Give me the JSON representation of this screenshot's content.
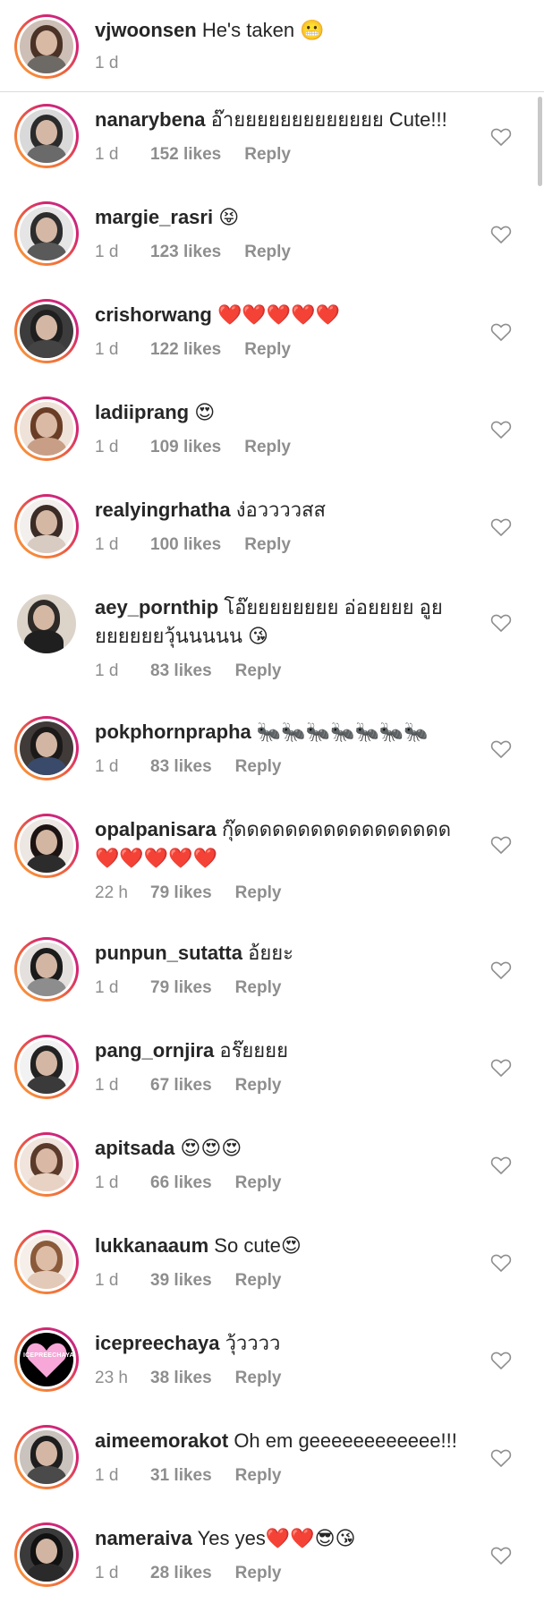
{
  "caption": {
    "username": "vjwoonsen",
    "text": "He's taken 😬",
    "time": "1 d"
  },
  "comments": [
    {
      "username": "nanarybena",
      "text": "อ๊ายยยยยยยยยยยยย Cute!!!",
      "time": "1 d",
      "likes": "152 likes",
      "reply": "Reply"
    },
    {
      "username": "margie_rasri",
      "text": "😝",
      "time": "1 d",
      "likes": "123 likes",
      "reply": "Reply"
    },
    {
      "username": "crishorwang",
      "text": "❤️❤️❤️❤️❤️",
      "time": "1 d",
      "likes": "122 likes",
      "reply": "Reply"
    },
    {
      "username": "ladiiprang",
      "text": "😍",
      "time": "1 d",
      "likes": "109 likes",
      "reply": "Reply"
    },
    {
      "username": "realyingrhatha",
      "text": "ง่อววววสส",
      "time": "1 d",
      "likes": "100 likes",
      "reply": "Reply"
    },
    {
      "username": "aey_pornthip",
      "text": "โอ๊ยยยยยยยย อ่อยยยย อูย ยยยยยยวุ้นนนนน 😘",
      "time": "1 d",
      "likes": "83 likes",
      "reply": "Reply"
    },
    {
      "username": "pokphornprapha",
      "text": "🐜🐜🐜🐜🐜🐜🐜",
      "time": "1 d",
      "likes": "83 likes",
      "reply": "Reply"
    },
    {
      "username": "opalpanisara",
      "text": "กุ๊ดดดดดดดดดดดดดดดดด ❤️❤️❤️❤️❤️",
      "time": "22 h",
      "likes": "79 likes",
      "reply": "Reply"
    },
    {
      "username": "punpun_sutatta",
      "text": "อ้ยยะ",
      "time": "1 d",
      "likes": "79 likes",
      "reply": "Reply"
    },
    {
      "username": "pang_ornjira",
      "text": "อร๊ยยยย",
      "time": "1 d",
      "likes": "67 likes",
      "reply": "Reply"
    },
    {
      "username": "apitsada",
      "text": "😍😍😍",
      "time": "1 d",
      "likes": "66 likes",
      "reply": "Reply"
    },
    {
      "username": "lukkanaaum",
      "text": "So cute😍",
      "time": "1 d",
      "likes": "39 likes",
      "reply": "Reply"
    },
    {
      "username": "icepreechaya",
      "text": "วุ้วววว",
      "time": "23 h",
      "likes": "38 likes",
      "reply": "Reply"
    },
    {
      "username": "aimeemorakot",
      "text": "Oh em geeeeeeeeeeee!!!",
      "time": "1 d",
      "likes": "31 likes",
      "reply": "Reply"
    },
    {
      "username": "nameraiva",
      "text": "Yes yes❤️❤️😎😘",
      "time": "1 d",
      "likes": "28 likes",
      "reply": "Reply"
    }
  ],
  "icepreechaya_avatar_text": "ICEPREECHAYA",
  "colors": {
    "text": "#262626",
    "secondary": "#8e8e8e",
    "story_ring_start": "#f9a23c",
    "story_ring_end": "#b82a95",
    "divider": "#dbdbdb"
  },
  "icons": {
    "like": "heart-outline-icon"
  }
}
